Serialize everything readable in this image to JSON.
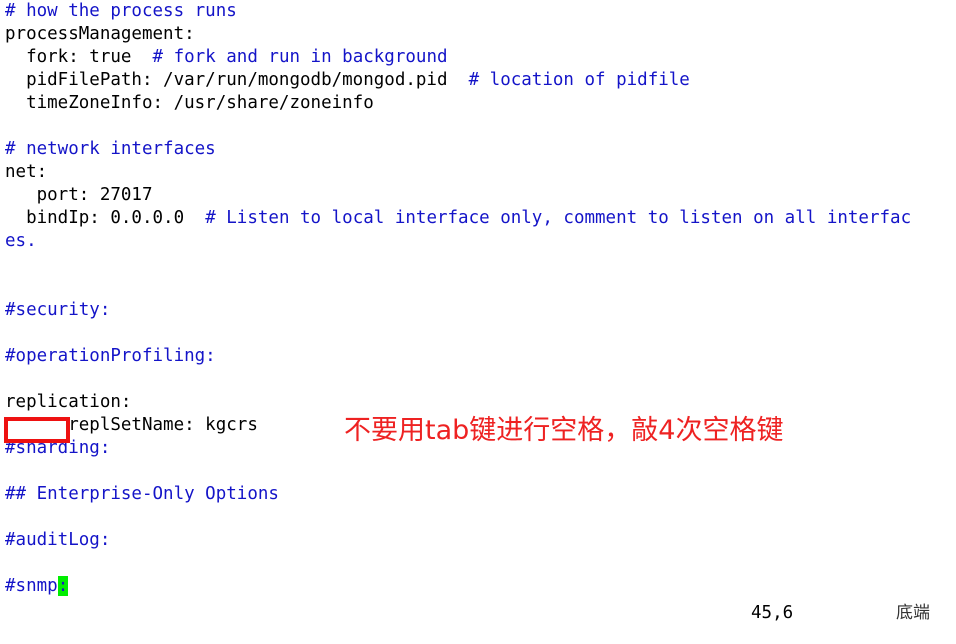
{
  "editor": {
    "background_color": "#ffffff",
    "text_color": "#000000",
    "comment_color": "#1414c8",
    "cursor_color": "#00ee00",
    "lines": [
      {
        "indent": "",
        "text": "# how the process runs",
        "kind": "comment"
      },
      {
        "indent": "",
        "text": "processManagement:",
        "kind": "plain"
      },
      {
        "indent": "",
        "text": "  fork: true",
        "kind": "plain",
        "comment": "  # fork and run in background"
      },
      {
        "indent": "",
        "text": "  pidFilePath: /var/run/mongodb/mongod.pid",
        "kind": "plain",
        "comment": "  # location of pidfile"
      },
      {
        "indent": "",
        "text": "  timeZoneInfo: /usr/share/zoneinfo",
        "kind": "plain"
      },
      {
        "indent": "",
        "text": "",
        "kind": "plain"
      },
      {
        "indent": "",
        "text": "# network interfaces",
        "kind": "comment"
      },
      {
        "indent": "",
        "text": "net:",
        "kind": "plain"
      },
      {
        "indent": "",
        "text": "   port: 27017",
        "kind": "plain"
      },
      {
        "indent": "",
        "text": "  bindIp: 0.0.0.0",
        "kind": "plain",
        "comment": "  # Listen to local interface only, comment to listen on all interfac"
      },
      {
        "indent": "",
        "text": "es.",
        "kind": "comment"
      },
      {
        "indent": "",
        "text": "",
        "kind": "plain"
      },
      {
        "indent": "",
        "text": "",
        "kind": "plain"
      },
      {
        "indent": "",
        "text": "#security:",
        "kind": "comment"
      },
      {
        "indent": "",
        "text": "",
        "kind": "plain"
      },
      {
        "indent": "",
        "text": "#operationProfiling:",
        "kind": "comment"
      },
      {
        "indent": "",
        "text": "",
        "kind": "plain"
      },
      {
        "indent": "",
        "text": "replication:",
        "kind": "plain"
      },
      {
        "indent": "",
        "text": "      replSetName: kgcrs",
        "kind": "plain"
      },
      {
        "indent": "",
        "text": "#sharding:",
        "kind": "comment"
      },
      {
        "indent": "",
        "text": "",
        "kind": "plain"
      },
      {
        "indent": "",
        "text": "## Enterprise-Only Options",
        "kind": "comment"
      },
      {
        "indent": "",
        "text": "",
        "kind": "plain"
      },
      {
        "indent": "",
        "text": "#auditLog:",
        "kind": "comment"
      },
      {
        "indent": "",
        "text": "",
        "kind": "plain"
      },
      {
        "indent": "",
        "text": "#snmp",
        "kind": "comment",
        "cursor_char": ":"
      }
    ]
  },
  "annotations": {
    "indent_box": {
      "label": "tab-indent-highlight",
      "color": "#ee1111"
    },
    "note": {
      "text": "不要用tab键进行空格，敲4次空格键",
      "color": "#ee2222"
    }
  },
  "status": {
    "position": "45,6",
    "state": "底端"
  }
}
